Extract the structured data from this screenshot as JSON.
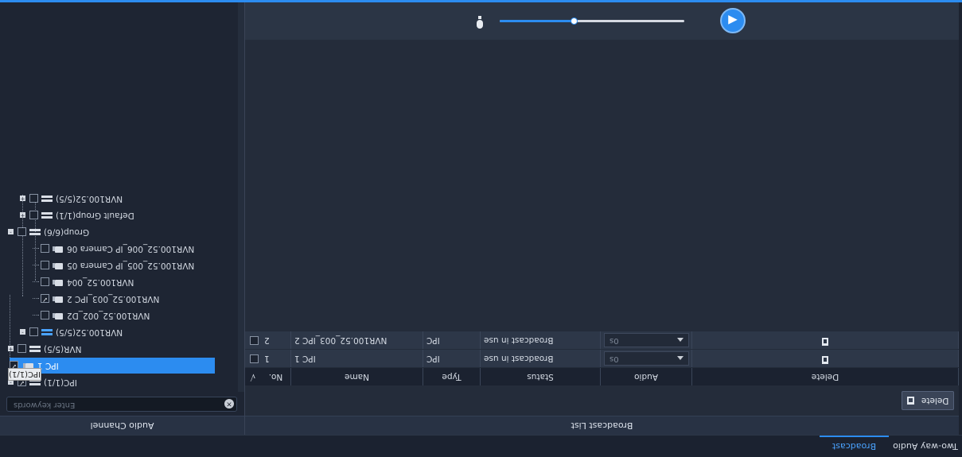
{
  "tabs": {
    "two_way_audio": "Two-way Audio",
    "broadcast": "Broadcast"
  },
  "audio_channel": {
    "title": "Audio Channel",
    "search_placeholder": "Enter keywords",
    "tooltip": "IPC(1/1)",
    "tree": [
      {
        "label": "IPC(1/1)",
        "type": "nvr",
        "checked": true
      },
      {
        "label": "IPC 1",
        "type": "cam",
        "checked": true,
        "selected": true
      },
      {
        "label": "NVR(5/5)",
        "type": "nvr",
        "checked": false
      },
      {
        "label": "NVR100.52(5/5)",
        "type": "nvr",
        "checked": false,
        "blue": true
      },
      {
        "label": "NVR100.52_002_D2",
        "type": "cam",
        "checked": false
      },
      {
        "label": "NVR100.52_003_IPC 2",
        "type": "cam",
        "checked": true
      },
      {
        "label": "NVR100.52_004",
        "type": "cam",
        "checked": false
      },
      {
        "label": "NVR100.52_005_IP Camera 05",
        "type": "cam",
        "checked": false
      },
      {
        "label": "NVR100.52_006_IP Camera 06",
        "type": "cam",
        "checked": false
      },
      {
        "label": "Group(6/6)",
        "type": "nvr",
        "checked": false
      },
      {
        "label": "Default Group(1/1)",
        "type": "nvr",
        "checked": false
      },
      {
        "label": "NVR100.52(5/5)",
        "type": "nvr",
        "checked": false
      }
    ]
  },
  "broadcast_list": {
    "title": "Broadcast List",
    "delete_label": "Delete",
    "columns": {
      "check": "√",
      "no": "No.",
      "name": "Name",
      "type": "Type",
      "status": "Status",
      "audio": "Audio",
      "delete": "Delete"
    },
    "rows": [
      {
        "no": "1",
        "name": "IPC 1",
        "type": "IPC",
        "status": "Broadcast in use",
        "audio": "0s"
      },
      {
        "no": "2",
        "name": "NVR100.52_003_IPC 2",
        "type": "IPC",
        "status": "Broadcast in use",
        "audio": "0s"
      }
    ]
  },
  "volume": {
    "level_percent": 40,
    "mic_icon": "microphone-icon",
    "speaker_icon": "broadcast-speaker-icon"
  },
  "colors": {
    "accent": "#2c8cf0",
    "background": "#1c2330"
  }
}
